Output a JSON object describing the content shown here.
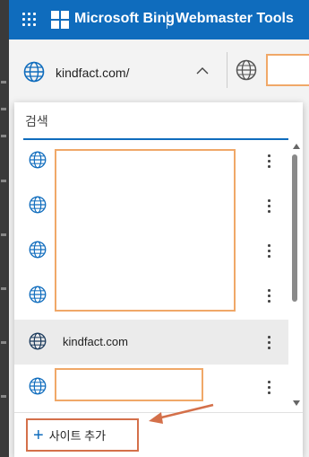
{
  "header": {
    "brand": "Microsoft Bing",
    "product": "Webmaster Tools"
  },
  "site_selector": {
    "current_site": "kindfact.com/"
  },
  "dropdown": {
    "search_placeholder": "검색",
    "items": [
      {
        "label": ""
      },
      {
        "label": ""
      },
      {
        "label": ""
      },
      {
        "label": ""
      },
      {
        "label": "kindfact.com",
        "selected": true
      },
      {
        "label": ""
      }
    ],
    "add_site_label": "사이트 추가"
  },
  "background_fragments": [
    "n",
    "동",
    "계",
    "d",
    "이",
    "a"
  ],
  "colors": {
    "header_bg": "#0f6cbd",
    "accent": "#0f6cbd",
    "redaction_border": "#f0a868",
    "annotation_arrow": "#d4704a"
  }
}
